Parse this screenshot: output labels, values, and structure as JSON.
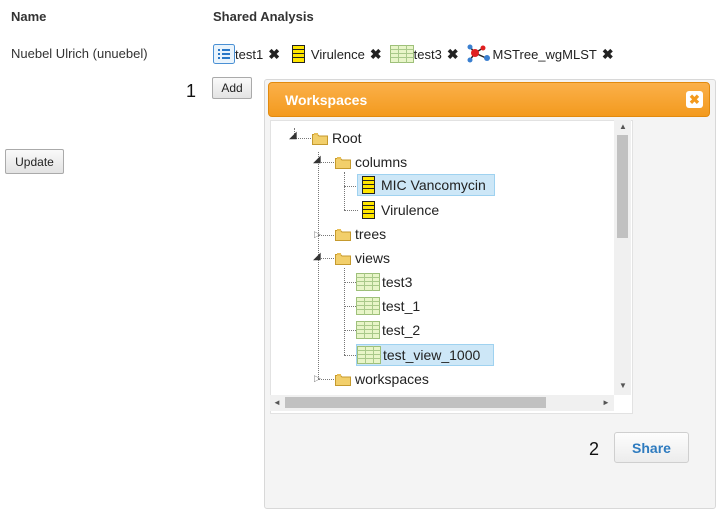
{
  "table": {
    "headers": [
      "Name",
      "Shared Analysis"
    ],
    "user": "Nuebel Ulrich (unuebel)",
    "shared": [
      {
        "label": "test1",
        "icon": "list-icon"
      },
      {
        "label": "Virulence",
        "icon": "column-icon"
      },
      {
        "label": "test3",
        "icon": "view-grid-icon"
      },
      {
        "label": "MSTree_wgMLST",
        "icon": "tree-network-icon"
      }
    ],
    "remove_glyph": "✖"
  },
  "buttons": {
    "add": "Add",
    "update": "Update",
    "share": "Share"
  },
  "annotations": [
    "1",
    "2"
  ],
  "dialog": {
    "title": "Workspaces",
    "close_glyph": "✖",
    "tree": {
      "root": "Root",
      "folders": [
        "columns",
        "trees",
        "views",
        "workspaces"
      ],
      "columns": [
        "MIC Vancomycin",
        "Virulence"
      ],
      "views": [
        "test3",
        "test_1",
        "test_2",
        "test_view_1000"
      ],
      "selected": [
        "MIC Vancomycin",
        "test_view_1000"
      ]
    },
    "scroll_glyphs": {
      "up": "▲",
      "down": "▼",
      "left": "◄",
      "right": "►"
    }
  },
  "colors": {
    "accent": "#f39a1e",
    "selection": "#cde7f7",
    "link": "#2e7bbf"
  }
}
